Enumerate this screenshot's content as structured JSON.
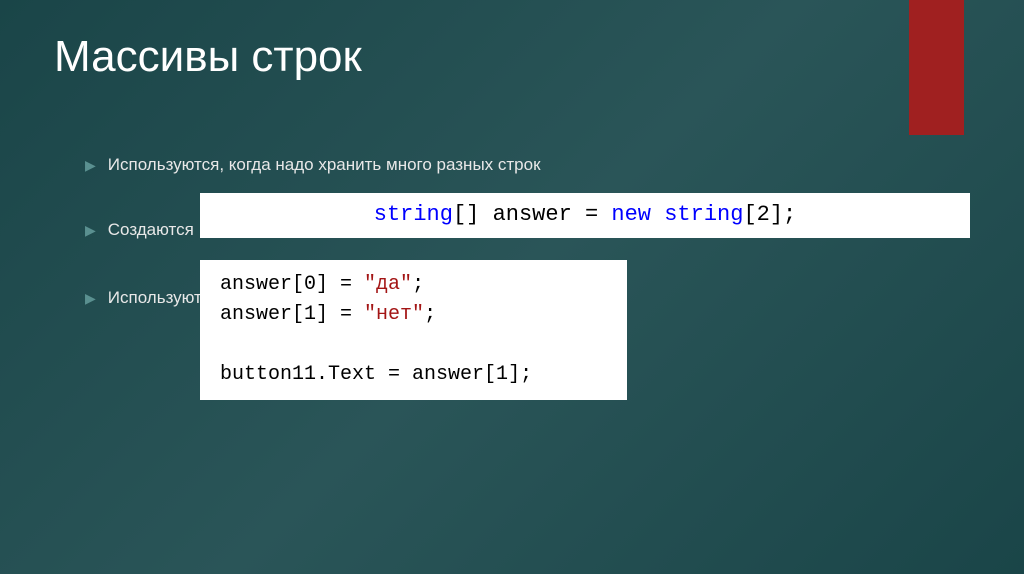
{
  "title": "Массивы строк",
  "bullets": [
    "Используются, когда надо хранить много разных строк",
    "Создаются",
    "Используются:"
  ],
  "code1": {
    "type": "string",
    "brackets": "[]",
    "varname": "answer",
    "equals": "=",
    "keyword": "new",
    "type2": "string",
    "size": "[2]",
    "semi": ";"
  },
  "code2": {
    "line1_var": "answer[0]",
    "line1_eq": " = ",
    "line1_str": "\"да\"",
    "line1_semi": ";",
    "line2_var": "answer[1]",
    "line2_eq": " = ",
    "line2_str": "\"нет\"",
    "line2_semi": ";",
    "line3_var": "button11.Text",
    "line3_eq": " = ",
    "line3_val": "answer[1]",
    "line3_semi": ";"
  }
}
